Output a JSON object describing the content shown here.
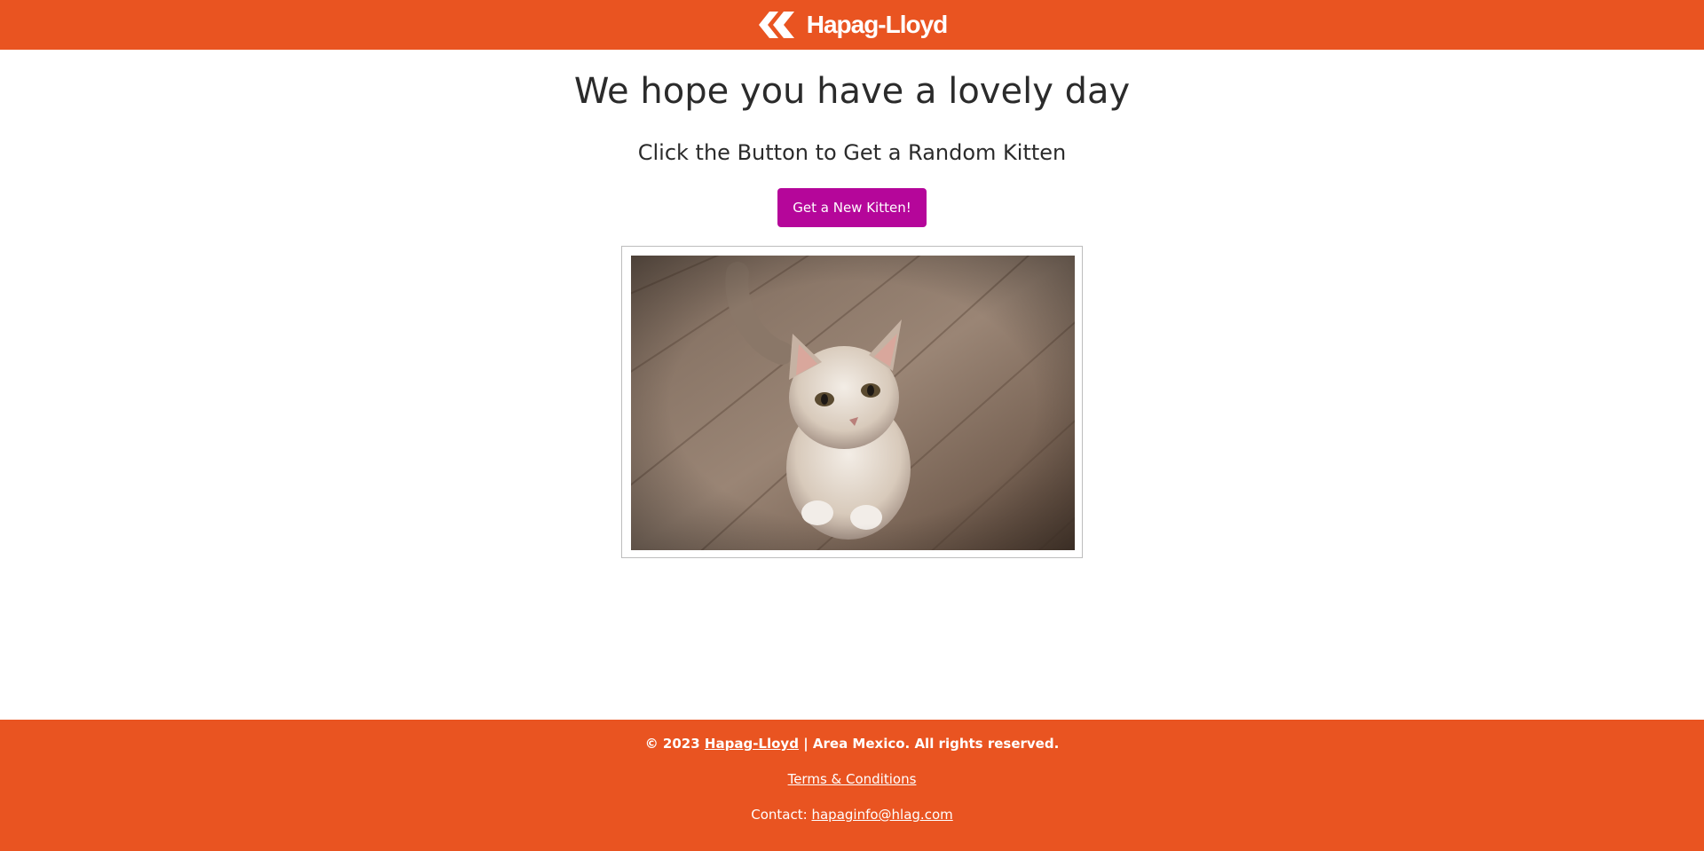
{
  "header": {
    "brand_name": "Hapag-Lloyd",
    "logo_icon": "hapag-lloyd-chevron-logo",
    "background_color": "#e95421"
  },
  "main": {
    "title": "We hope you have a lovely day",
    "subtitle": "Click the Button to Get a Random Kitten",
    "button_label": "Get a New Kitten!",
    "button_color": "#b5069a",
    "image_alt": "kitten"
  },
  "footer": {
    "copyright_prefix": "© 2023",
    "company_link": "Hapag-Lloyd",
    "copyright_suffix": "| Area Mexico. All rights reserved.",
    "terms_link": "Terms & Conditions",
    "contact_label": "Contact:",
    "contact_email": "hapaginfo@hlag.com"
  }
}
